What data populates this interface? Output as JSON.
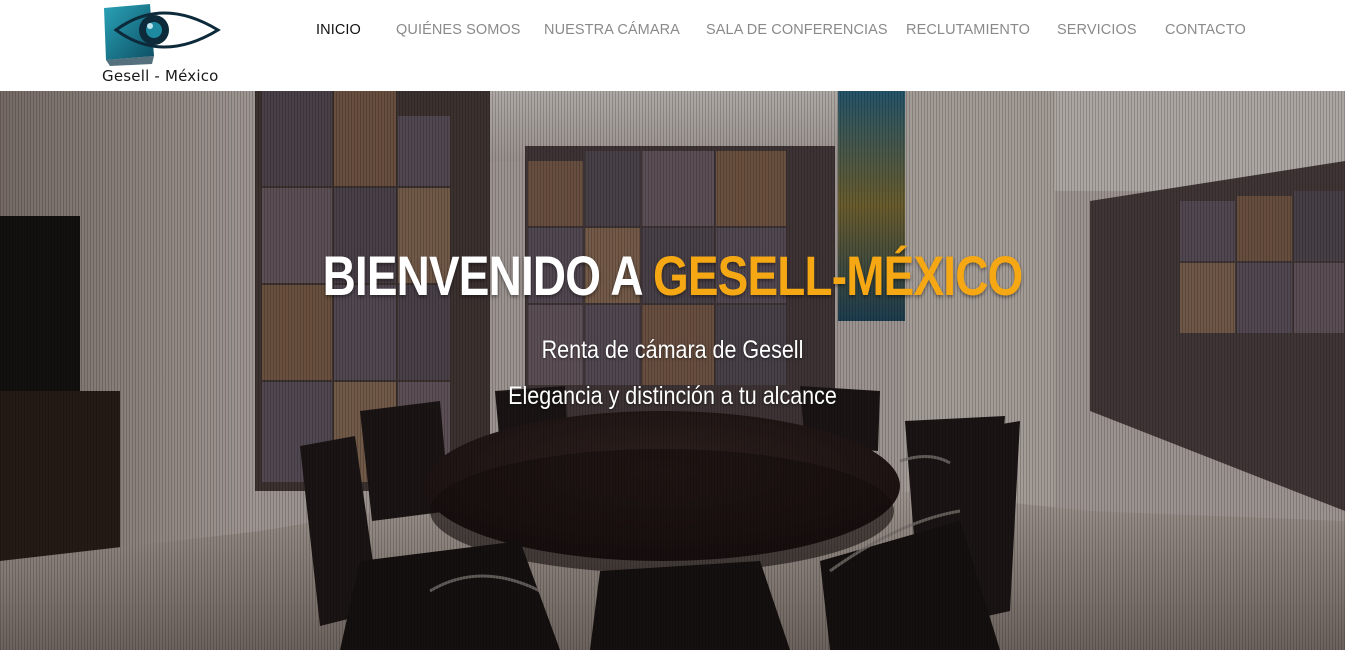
{
  "brand": {
    "logo_icon": "eye-logo-icon",
    "name": "Gesell - México",
    "colors": {
      "logo_teal": "#1d8aa0",
      "logo_dark": "#0d2a3a"
    }
  },
  "nav": {
    "items": [
      {
        "label": "INICIO",
        "active": true
      },
      {
        "label": "QUIÉNES SOMOS",
        "active": false
      },
      {
        "label": "NUESTRA CÁMARA",
        "active": false
      },
      {
        "label": "SALA DE CONFERENCIAS",
        "active": false
      },
      {
        "label": "RECLUTAMIENTO",
        "active": false
      },
      {
        "label": "SERVICIOS",
        "active": false
      },
      {
        "label": "CONTACTO",
        "active": false
      }
    ]
  },
  "hero": {
    "title_main": "BIENVENIDO A",
    "title_accent": "GESELL-MÉXICO",
    "subtitle_1": "Renta de cámara de Gesell",
    "subtitle_2": "Elegancia y distinción a tu alcance",
    "colors": {
      "accent": "#f5a814",
      "text": "#ffffff"
    }
  }
}
